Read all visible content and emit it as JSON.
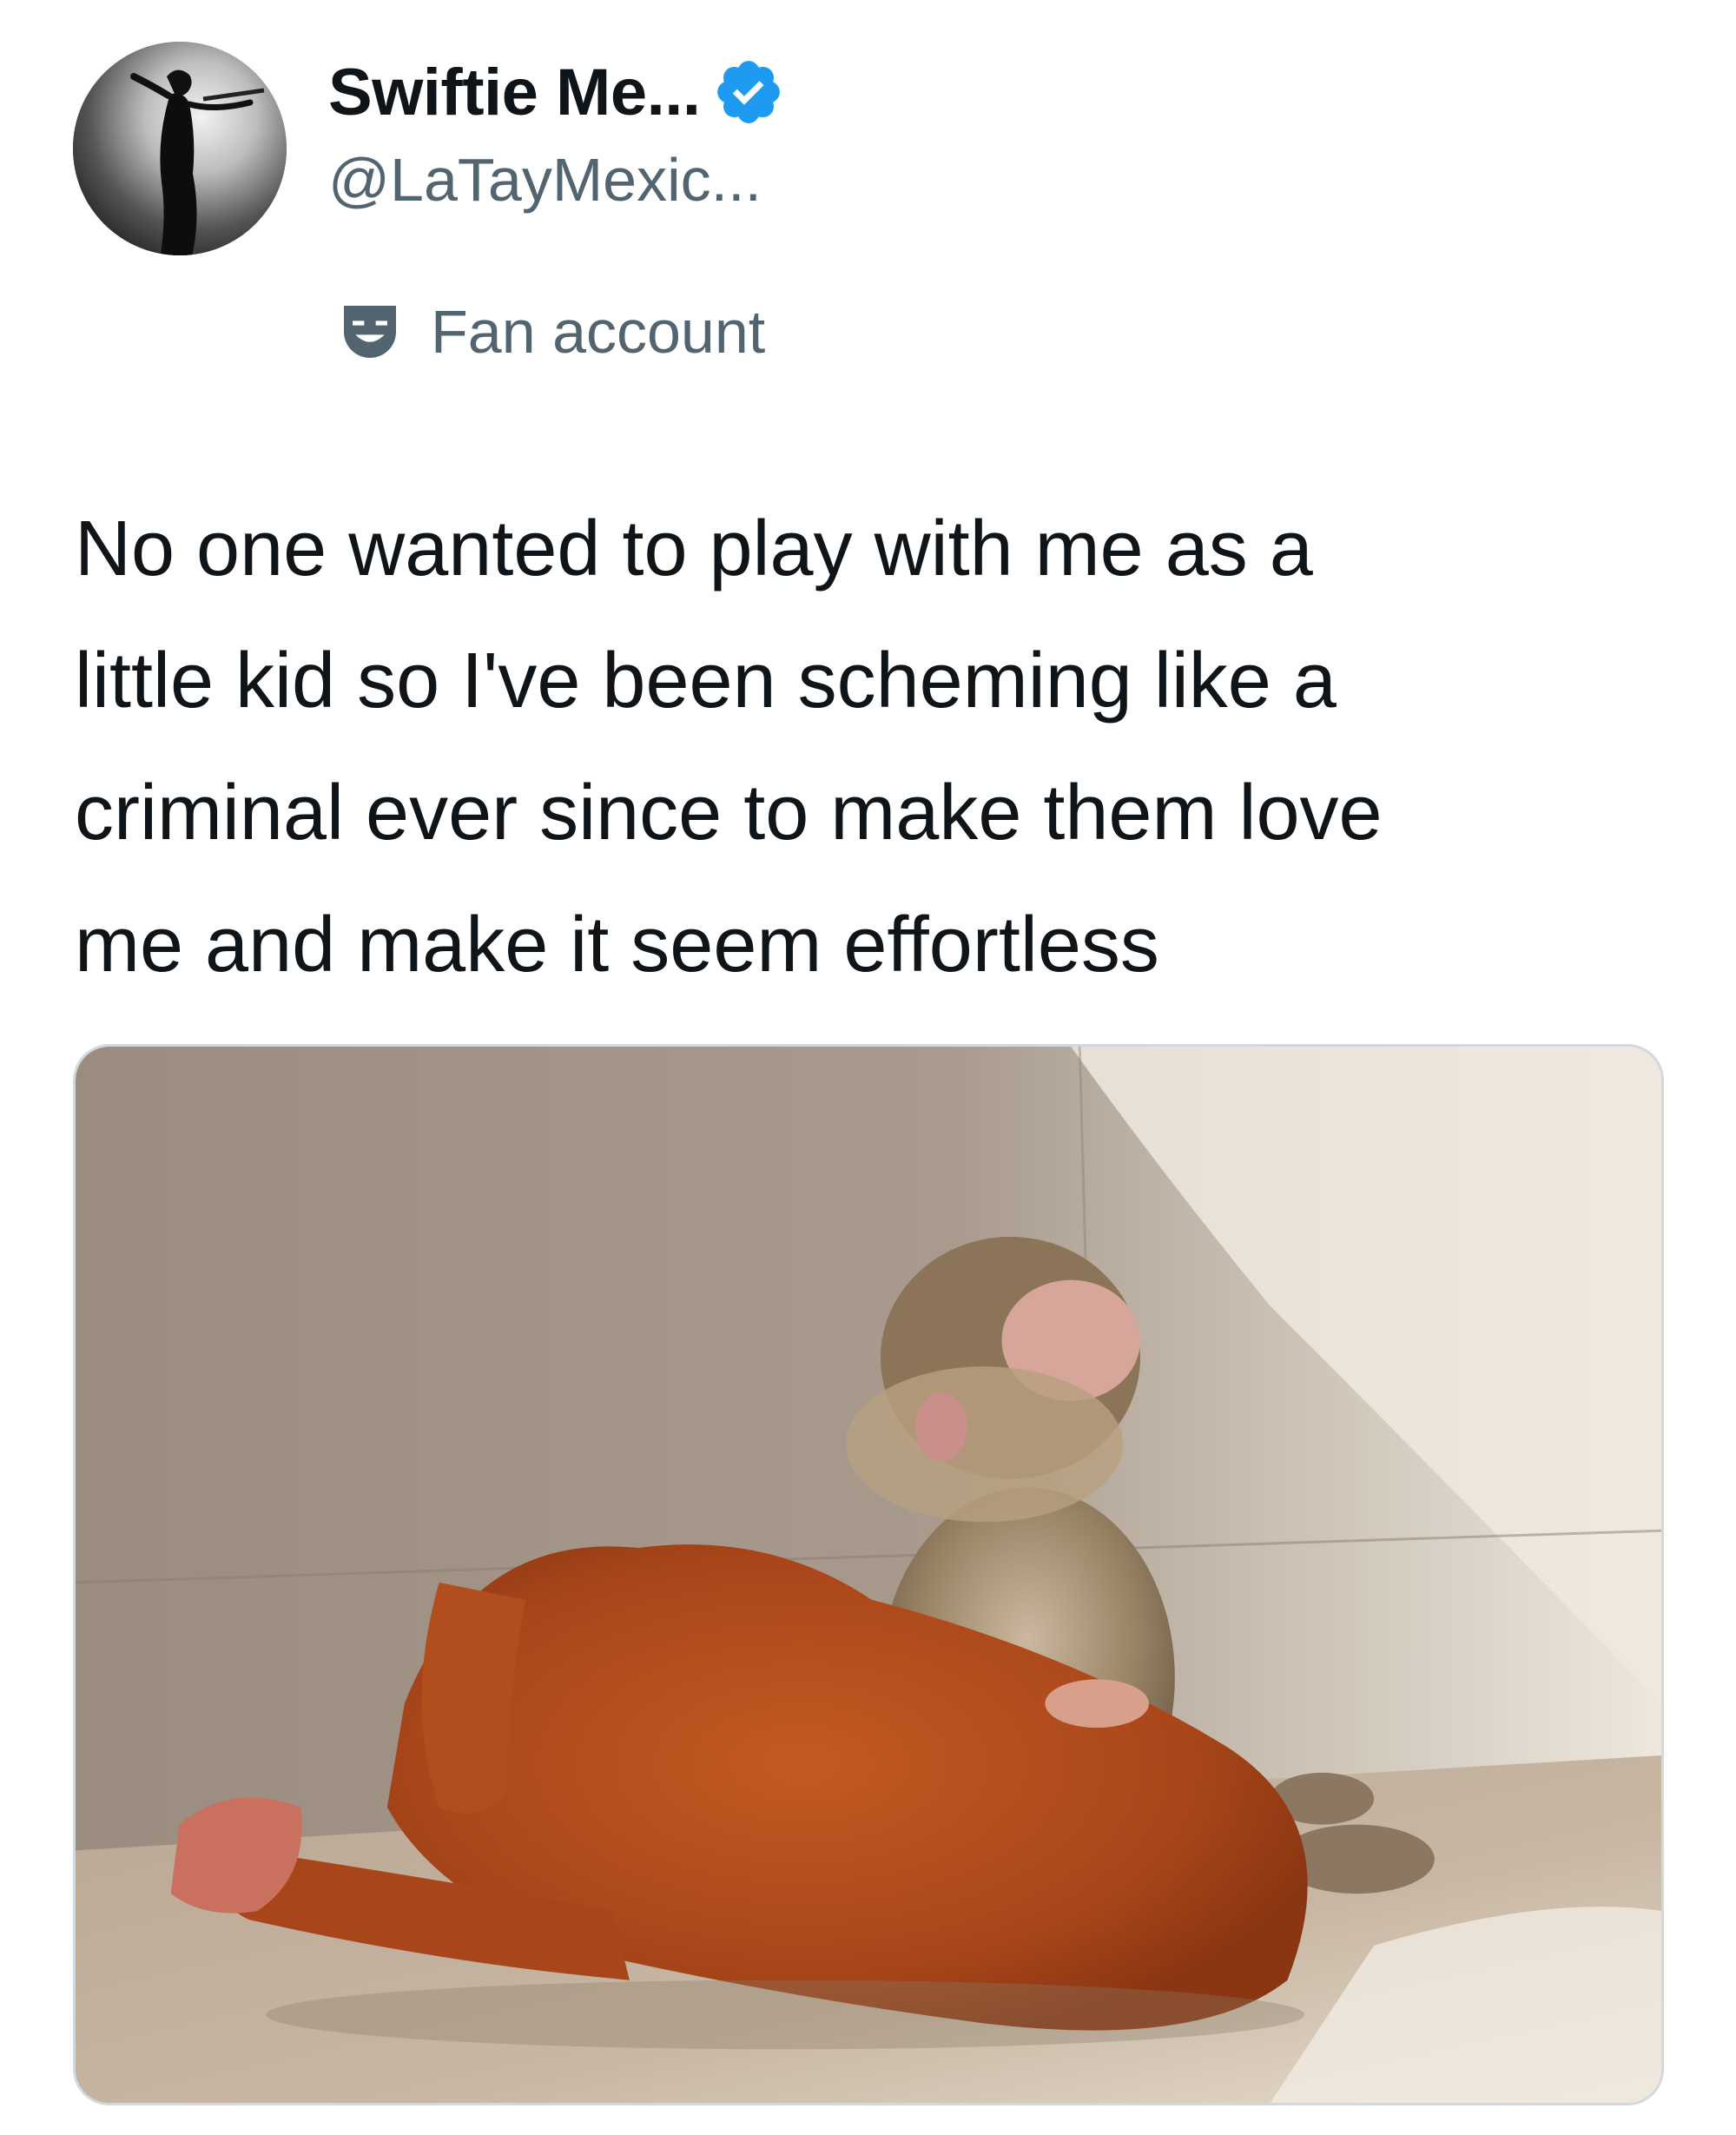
{
  "author": {
    "display_name": "Swiftie Me...",
    "handle": "@LaTayMexic...",
    "verified": true,
    "verified_color": "#1d9bf0",
    "avatar_icon": "user-avatar"
  },
  "label": {
    "icon": "theater-mask-icon",
    "text": "Fan account"
  },
  "tweet": {
    "text": "No one wanted to play with me as a\nlittle kid so I've been scheming like a\ncriminal ever since to make them love\nme and make it seem effortless"
  },
  "media": {
    "kind": "photo"
  },
  "colors": {
    "text_primary": "#0f1419",
    "text_secondary": "#536471",
    "border": "#cfd9de",
    "verified_blue": "#1d9bf0"
  }
}
